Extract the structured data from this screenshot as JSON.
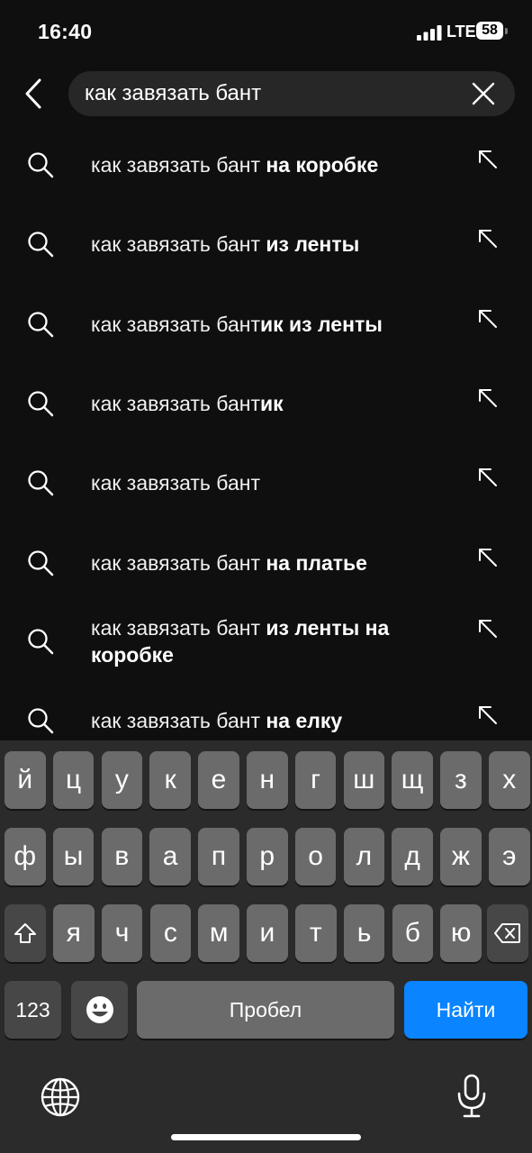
{
  "status_bar": {
    "time": "16:40",
    "network": "LTE",
    "battery": "58"
  },
  "search": {
    "query": "как завязать бант",
    "back_icon": "chevron-left-icon",
    "clear_icon": "close-icon"
  },
  "suggestions": [
    {
      "prefix": "как завязать бант",
      "completion": " на коробке"
    },
    {
      "prefix": "как завязать бант",
      "completion": " из ленты"
    },
    {
      "prefix": "как завязать бант",
      "completion": "ик из ленты"
    },
    {
      "prefix": "как завязать бант",
      "completion": "ик"
    },
    {
      "prefix": "как завязать бант",
      "completion": ""
    },
    {
      "prefix": "как завязать бант",
      "completion": " на платье"
    },
    {
      "prefix": "как завязать бант",
      "completion": " из ленты на коробке"
    },
    {
      "prefix": "как завязать бант",
      "completion": " на елку"
    }
  ],
  "keyboard": {
    "row1": [
      "й",
      "ц",
      "у",
      "к",
      "е",
      "н",
      "г",
      "ш",
      "щ",
      "з",
      "х"
    ],
    "row2": [
      "ф",
      "ы",
      "в",
      "а",
      "п",
      "р",
      "о",
      "л",
      "д",
      "ж",
      "э"
    ],
    "row3": [
      "я",
      "ч",
      "с",
      "м",
      "и",
      "т",
      "ь",
      "б",
      "ю"
    ],
    "numbers_label": "123",
    "space_label": "Пробел",
    "go_label": "Найти",
    "icons": {
      "shift": "shift-icon",
      "delete": "backspace-icon",
      "emoji": "emoji-icon",
      "globe": "globe-icon",
      "mic": "microphone-icon"
    },
    "go_color": "#0a84ff"
  }
}
